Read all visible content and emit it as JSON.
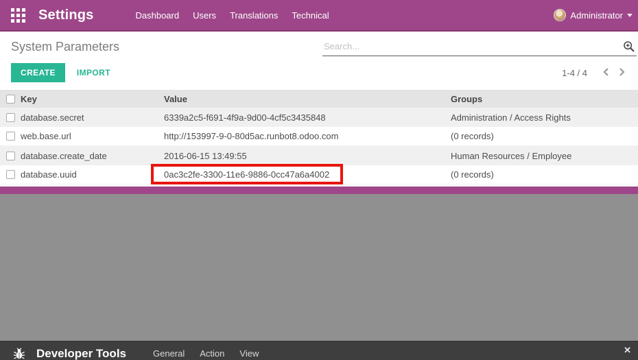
{
  "topbar": {
    "app_title": "Settings",
    "menu": [
      "Dashboard",
      "Users",
      "Translations",
      "Technical"
    ],
    "user_name": "Administrator"
  },
  "control_panel": {
    "title": "System Parameters",
    "search_placeholder": "Search...",
    "search_value": "",
    "create_label": "CREATE",
    "import_label": "IMPORT",
    "pager_text": "1-4 / 4"
  },
  "table": {
    "headers": {
      "key": "Key",
      "value": "Value",
      "groups": "Groups"
    },
    "rows": [
      {
        "key": "database.secret",
        "value": "6339a2c5-f691-4f9a-9d00-4cf5c3435848",
        "groups": "Administration / Access Rights"
      },
      {
        "key": "web.base.url",
        "value": "http://153997-9-0-80d5ac.runbot8.odoo.com",
        "groups": "(0 records)"
      },
      {
        "key": "database.create_date",
        "value": "2016-06-15 13:49:55",
        "groups": "Human Resources / Employee"
      },
      {
        "key": "database.uuid",
        "value": "0ac3c2fe-3300-11e6-9886-0cc47a6a4002",
        "groups": "(0 records)",
        "highlighted": true
      }
    ]
  },
  "devtools": {
    "title": "Developer Tools",
    "menu": [
      "General",
      "Action",
      "View"
    ],
    "close_glyph": "✕"
  },
  "colors": {
    "brand": "#9E4689",
    "accent": "#28B694",
    "highlight_red": "#E8150D",
    "backdrop_gray": "#909090",
    "devbar_dark": "#3E3E3E"
  }
}
